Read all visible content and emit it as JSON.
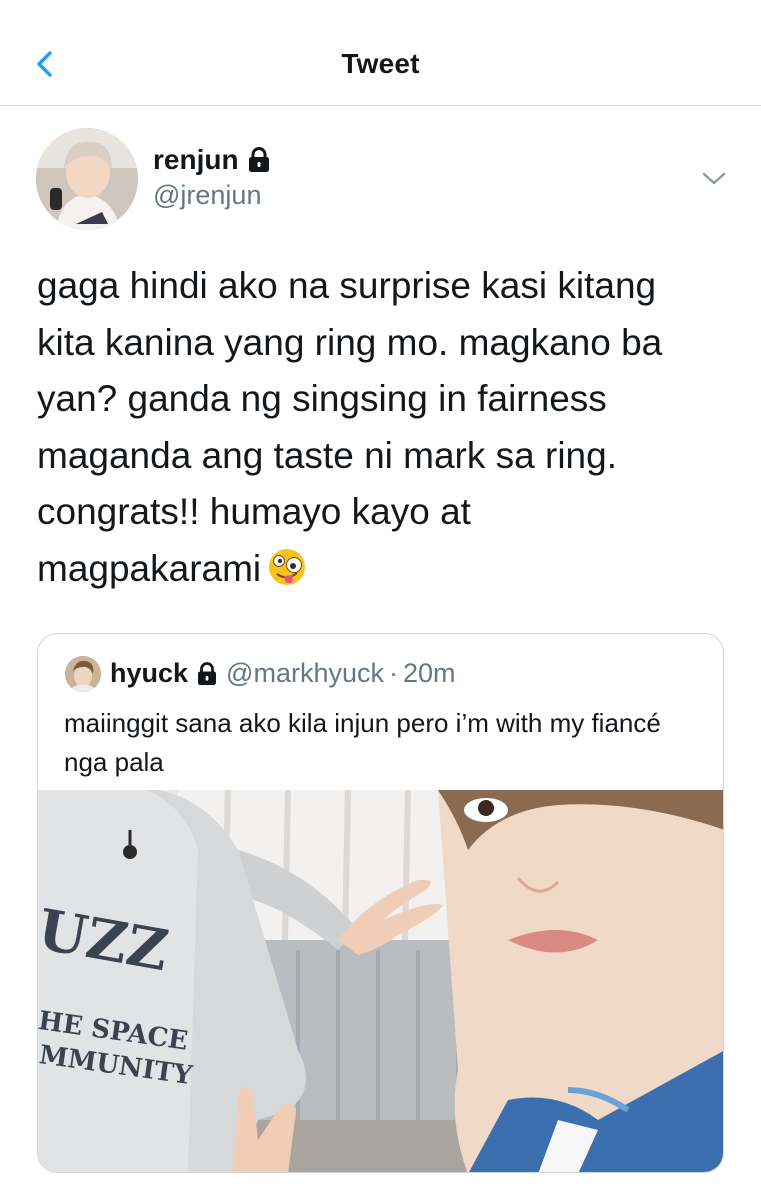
{
  "header": {
    "title": "Tweet",
    "back_icon": "chevron-left-icon"
  },
  "tweet": {
    "author": {
      "display_name": "renjun",
      "handle": "@jrenjun",
      "protected_icon": "lock-icon"
    },
    "text": "gaga hindi ako na surprise kasi kitang\nkita kanina yang ring mo. magkano ba\nyan? ganda ng singsing in fairness\nmaganda ang taste ni mark sa ring.\ncongrats!! humayo kayo at\nmagpakarami",
    "emoji": "zany-face-emoji",
    "menu_icon": "chevron-down-icon"
  },
  "quoted_tweet": {
    "display_name": "hyuck",
    "handle": "@markhyuck",
    "separator": "·",
    "time": "20m",
    "text": "maiinggit sana ako kila injun pero i’m with my fiancé nga pala",
    "image_lettering": [
      "UZZ",
      "HE SPACE",
      "MMUNITY"
    ]
  },
  "colors": {
    "accent": "#1da1f2",
    "secondary_text": "#657786",
    "divider": "#d9dde1"
  }
}
